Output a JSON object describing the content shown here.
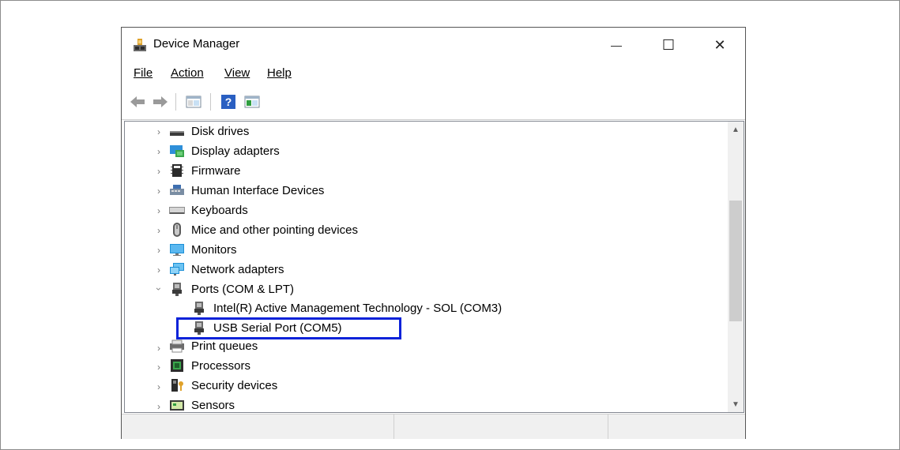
{
  "window": {
    "title": "Device Manager",
    "controls": {
      "minimize": "—",
      "maximize": "☐",
      "close": "✕"
    }
  },
  "menubar": [
    {
      "label": "File"
    },
    {
      "label": "Action"
    },
    {
      "label": "View"
    },
    {
      "label": "Help"
    }
  ],
  "toolbar": [
    "back-icon",
    "forward-icon",
    "properties-icon",
    "help-icon",
    "update-driver-icon"
  ],
  "tree": {
    "items": [
      {
        "label": "Disk drives",
        "expanded": false,
        "icon": "disk-drive-icon"
      },
      {
        "label": "Display adapters",
        "expanded": false,
        "icon": "display-adapter-icon"
      },
      {
        "label": "Firmware",
        "expanded": false,
        "icon": "firmware-icon"
      },
      {
        "label": "Human Interface Devices",
        "expanded": false,
        "icon": "hid-icon"
      },
      {
        "label": "Keyboards",
        "expanded": false,
        "icon": "keyboard-icon"
      },
      {
        "label": "Mice and other pointing devices",
        "expanded": false,
        "icon": "mouse-icon"
      },
      {
        "label": "Monitors",
        "expanded": false,
        "icon": "monitor-icon"
      },
      {
        "label": "Network adapters",
        "expanded": false,
        "icon": "network-adapter-icon"
      },
      {
        "label": "Ports (COM & LPT)",
        "expanded": true,
        "icon": "port-icon",
        "children": [
          {
            "label": "Intel(R) Active Management Technology - SOL (COM3)",
            "icon": "port-icon"
          },
          {
            "label": "USB Serial Port (COM5)",
            "icon": "port-icon",
            "highlighted": true
          }
        ]
      },
      {
        "label": "Print queues",
        "expanded": false,
        "icon": "printer-icon"
      },
      {
        "label": "Processors",
        "expanded": false,
        "icon": "processor-icon"
      },
      {
        "label": "Security devices",
        "expanded": false,
        "icon": "security-device-icon"
      },
      {
        "label": "Sensors",
        "expanded": false,
        "icon": "sensor-icon"
      }
    ]
  },
  "colors": {
    "highlight_border": "#0a22d9",
    "accent": "#1e90d6"
  }
}
